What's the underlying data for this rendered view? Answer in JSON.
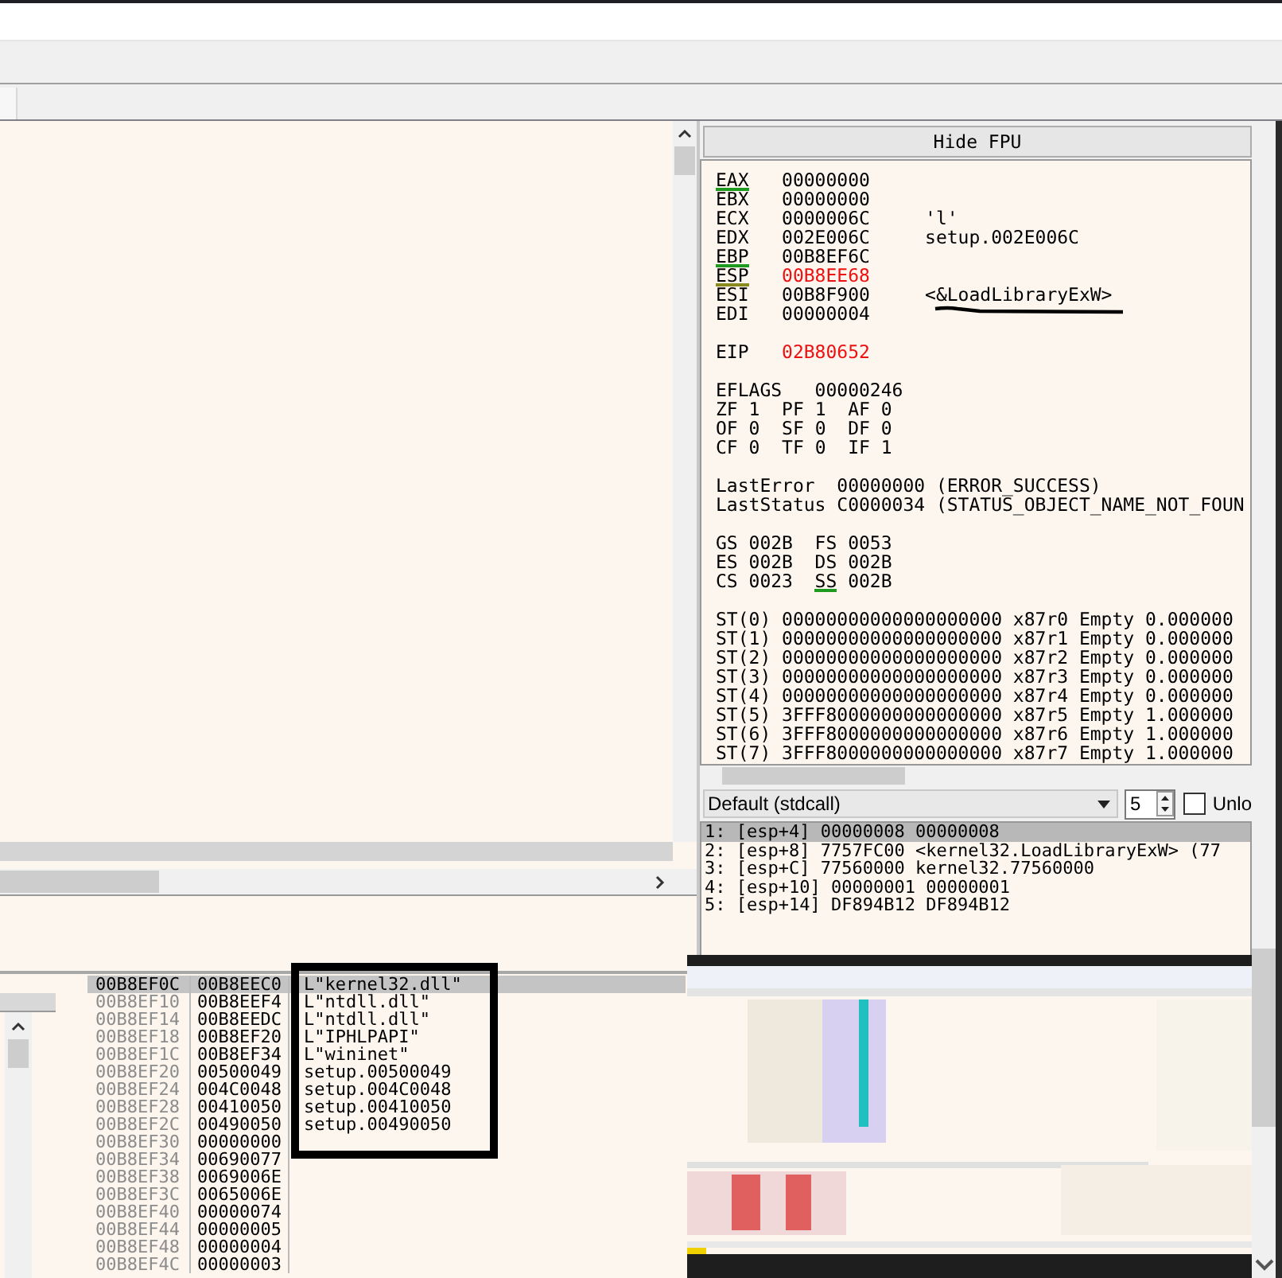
{
  "fpu_toggle": {
    "label": "Hide FPU"
  },
  "registers": [
    {
      "kind": "reg",
      "name": "EAX",
      "value": "00000000",
      "changed": false,
      "color": "#1e9a1e"
    },
    {
      "kind": "reg",
      "name": "EBX",
      "value": "00000000",
      "changed": false
    },
    {
      "kind": "reg",
      "name": "ECX",
      "value": "0000006C",
      "changed": false,
      "comment": "'l'"
    },
    {
      "kind": "reg",
      "name": "EDX",
      "value": "002E006C",
      "changed": false,
      "comment": "setup.002E006C"
    },
    {
      "kind": "reg",
      "name": "EBP",
      "value": "00B8EF6C",
      "changed": false,
      "color": "#1e9a1e"
    },
    {
      "kind": "reg",
      "name": "ESP",
      "value": "00B8EE68",
      "changed": true,
      "color": "#8a8a1e"
    },
    {
      "kind": "reg",
      "name": "ESI",
      "value": "00B8F900",
      "changed": false,
      "comment": "<&LoadLibraryExW>"
    },
    {
      "kind": "reg",
      "name": "EDI",
      "value": "00000004",
      "changed": false
    },
    {
      "kind": "gap"
    },
    {
      "kind": "reg",
      "name": "EIP",
      "value": "02B80652",
      "changed": true
    },
    {
      "kind": "gap"
    },
    {
      "kind": "eflags",
      "name": "EFLAGS",
      "value": "00000246"
    },
    {
      "kind": "flags",
      "pairs": [
        {
          "name": "ZF",
          "value": "1"
        },
        {
          "name": "PF",
          "value": "1"
        },
        {
          "name": "AF",
          "value": "0"
        }
      ]
    },
    {
      "kind": "flags",
      "pairs": [
        {
          "name": "OF",
          "value": "0"
        },
        {
          "name": "SF",
          "value": "0"
        },
        {
          "name": "DF",
          "value": "0"
        }
      ]
    },
    {
      "kind": "flags",
      "pairs": [
        {
          "name": "CF",
          "value": "0"
        },
        {
          "name": "TF",
          "value": "0"
        },
        {
          "name": "IF",
          "value": "1"
        }
      ]
    },
    {
      "kind": "gap"
    },
    {
      "kind": "status",
      "name": "LastError",
      "value": "00000000",
      "comment": "(ERROR_SUCCESS)"
    },
    {
      "kind": "status",
      "name": "LastStatus",
      "value": "C0000034",
      "comment": "(STATUS_OBJECT_NAME_NOT_FOUN"
    },
    {
      "kind": "gap"
    },
    {
      "kind": "segments",
      "pairs": [
        {
          "name": "GS",
          "value": "002B"
        },
        {
          "name": "FS",
          "value": "0053"
        }
      ]
    },
    {
      "kind": "segments",
      "pairs": [
        {
          "name": "ES",
          "value": "002B"
        },
        {
          "name": "DS",
          "value": "002B"
        }
      ]
    },
    {
      "kind": "segments",
      "pairs": [
        {
          "name": "CS",
          "value": "0023"
        },
        {
          "name": "SS",
          "value": "002B",
          "color": "#1e9a1e"
        }
      ]
    },
    {
      "kind": "gap"
    },
    {
      "kind": "fpu",
      "name": "ST(0)",
      "value": "00000000000000000000",
      "tag": "x87r0",
      "status": "Empty",
      "comment": "0.000000"
    },
    {
      "kind": "fpu",
      "name": "ST(1)",
      "value": "00000000000000000000",
      "tag": "x87r1",
      "status": "Empty",
      "comment": "0.000000"
    },
    {
      "kind": "fpu",
      "name": "ST(2)",
      "value": "00000000000000000000",
      "tag": "x87r2",
      "status": "Empty",
      "comment": "0.000000"
    },
    {
      "kind": "fpu",
      "name": "ST(3)",
      "value": "00000000000000000000",
      "tag": "x87r3",
      "status": "Empty",
      "comment": "0.000000"
    },
    {
      "kind": "fpu",
      "name": "ST(4)",
      "value": "00000000000000000000",
      "tag": "x87r4",
      "status": "Empty",
      "comment": "0.000000"
    },
    {
      "kind": "fpu",
      "name": "ST(5)",
      "value": "3FFF8000000000000000",
      "tag": "x87r5",
      "status": "Empty",
      "comment": "1.000000"
    },
    {
      "kind": "fpu",
      "name": "ST(6)",
      "value": "3FFF8000000000000000",
      "tag": "x87r6",
      "status": "Empty",
      "comment": "1.000000"
    },
    {
      "kind": "fpu",
      "name": "ST(7)",
      "value": "3FFF8000000000000000",
      "tag": "x87r7",
      "status": "Empty",
      "comment": "1.000000"
    }
  ],
  "call_convention": {
    "value": "Default (stdcall)",
    "count": "5",
    "unlock": {
      "label": "Unlo",
      "checked": false
    }
  },
  "arguments": [
    {
      "text": "1: [esp+4] 00000008 00000008",
      "selected": true
    },
    {
      "text": "2: [esp+8] 7757FC00 <kernel32.LoadLibraryExW> (77",
      "selected": false
    },
    {
      "text": "3: [esp+C] 77560000 kernel32.77560000",
      "selected": false
    },
    {
      "text": "4: [esp+10] 00000001 00000001",
      "selected": false
    },
    {
      "text": "5: [esp+14] DF894B12 DF894B12",
      "selected": false
    }
  ],
  "stack": [
    {
      "address": "00B8EF0C",
      "value": "00B8EEC0",
      "comment": "L\"kernel32.dll\"",
      "selected": true
    },
    {
      "address": "00B8EF10",
      "value": "00B8EEF4",
      "comment": "L\"ntdll.dll\"",
      "selected": false
    },
    {
      "address": "00B8EF14",
      "value": "00B8EEDC",
      "comment": "L\"ntdll.dll\"",
      "selected": false
    },
    {
      "address": "00B8EF18",
      "value": "00B8EF20",
      "comment": "L\"IPHLPAPI\"",
      "selected": false
    },
    {
      "address": "00B8EF1C",
      "value": "00B8EF34",
      "comment": "L\"wininet\"",
      "selected": false
    },
    {
      "address": "00B8EF20",
      "value": "00500049",
      "comment": "setup.00500049",
      "selected": false
    },
    {
      "address": "00B8EF24",
      "value": "004C0048",
      "comment": "setup.004C0048",
      "selected": false
    },
    {
      "address": "00B8EF28",
      "value": "00410050",
      "comment": "setup.00410050",
      "selected": false
    },
    {
      "address": "00B8EF2C",
      "value": "00490050",
      "comment": "setup.00490050",
      "selected": false
    },
    {
      "address": "00B8EF30",
      "value": "00000000",
      "selected": false
    },
    {
      "address": "00B8EF34",
      "value": "00690077",
      "selected": false
    },
    {
      "address": "00B8EF38",
      "value": "0069006E",
      "selected": false
    },
    {
      "address": "00B8EF3C",
      "value": "0065006E",
      "selected": false
    },
    {
      "address": "00B8EF40",
      "value": "00000074",
      "selected": false
    },
    {
      "address": "00B8EF44",
      "value": "00000005",
      "selected": false
    },
    {
      "address": "00B8EF48",
      "value": "00000004",
      "selected": false
    },
    {
      "address": "00B8EF4C",
      "value": "00000003",
      "selected": false
    }
  ]
}
